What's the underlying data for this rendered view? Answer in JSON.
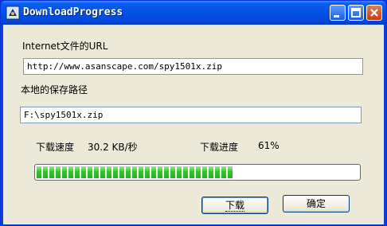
{
  "window": {
    "title": "DownloadProgress",
    "controls": {
      "minimize": "minimize",
      "maximize": "maximize",
      "close": "close"
    }
  },
  "form": {
    "url_label": "Internet文件的URL",
    "url_value": "http://www.asanscape.com/spy1501x.zip",
    "save_label": "本地的保存路径",
    "save_value": "F:\\spy1501x.zip",
    "speed_label": "下载速度",
    "speed_value": "30.2 KB/秒",
    "progress_label": "下载进度",
    "progress_value": "61%",
    "progress_fraction": 0.61
  },
  "buttons": {
    "download": "下载",
    "ok": "确定"
  },
  "colors": {
    "title_bar": "#0351e6",
    "progress_fill": "#2ec824",
    "face": "#ece9d8"
  }
}
